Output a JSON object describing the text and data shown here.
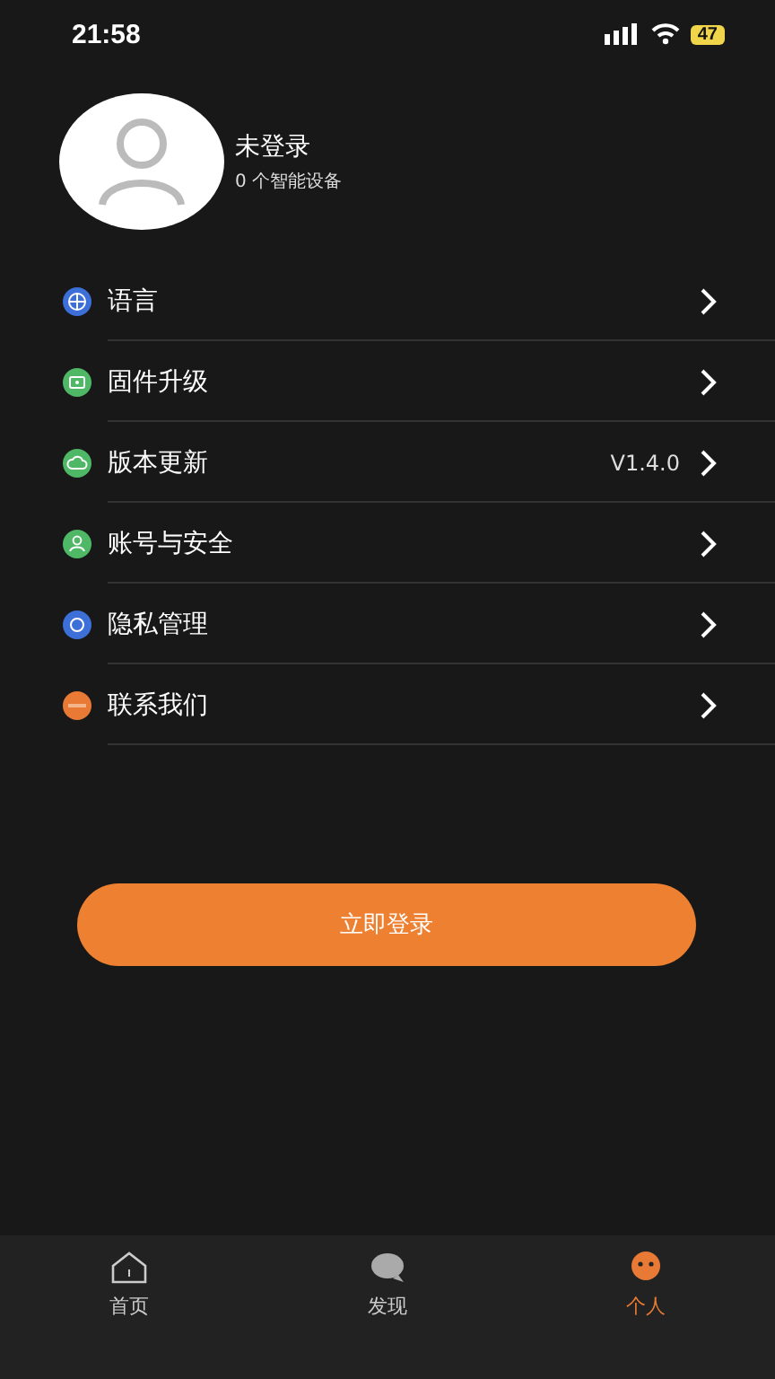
{
  "status_bar": {
    "time": "21:58",
    "battery": "47"
  },
  "profile": {
    "name": "未登录",
    "devices": "0 个智能设备"
  },
  "menu": [
    {
      "label": "语言",
      "kind": "globe",
      "color": "#3d6fd9"
    },
    {
      "label": "固件升级",
      "kind": "chip",
      "color": "#4fb867"
    },
    {
      "label": "版本更新",
      "kind": "cloud",
      "color": "#4fb867",
      "value": "V1.4.0"
    },
    {
      "label": "账号与安全",
      "kind": "user",
      "color": "#4fb867"
    },
    {
      "label": "隐私管理",
      "kind": "ring",
      "color": "#3d6fd9"
    },
    {
      "label": "联系我们",
      "kind": "pill",
      "color": "#e87a35"
    }
  ],
  "login_button": "立即登录",
  "tabs": [
    {
      "label": "首页",
      "kind": "home",
      "selected": false
    },
    {
      "label": "发现",
      "kind": "bubble",
      "selected": false
    },
    {
      "label": "个人",
      "kind": "face",
      "selected": true
    }
  ]
}
